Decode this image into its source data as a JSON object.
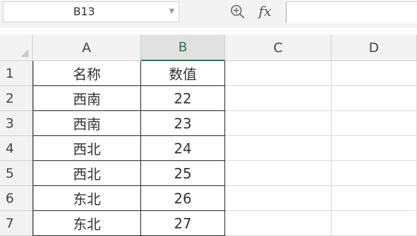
{
  "formula_bar": {
    "name_box": "B13",
    "zoom_icon": "magnifier-zoom-icon",
    "fx_label": "fx",
    "formula_value": ""
  },
  "columns": [
    "A",
    "B",
    "C",
    "D"
  ],
  "selected_column": "B",
  "rows": [
    {
      "num": "1",
      "a": "名称",
      "b": "数值"
    },
    {
      "num": "2",
      "a": "西南",
      "b": "22"
    },
    {
      "num": "3",
      "a": "西南",
      "b": "23"
    },
    {
      "num": "4",
      "a": "西北",
      "b": "24"
    },
    {
      "num": "5",
      "a": "西北",
      "b": "25"
    },
    {
      "num": "6",
      "a": "东北",
      "b": "26"
    },
    {
      "num": "7",
      "a": "东北",
      "b": "27"
    }
  ]
}
